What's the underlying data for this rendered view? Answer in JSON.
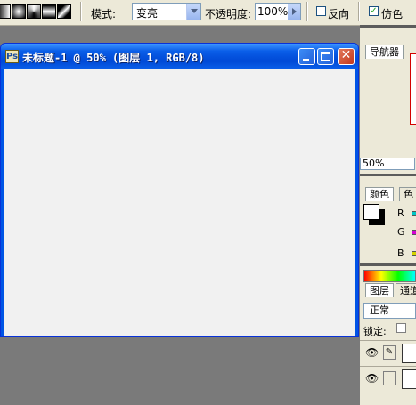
{
  "options_bar": {
    "gradient_types": [
      "linear-gradient-icon",
      "radial-gradient-icon",
      "angle-gradient-icon",
      "reflected-gradient-icon",
      "diamond-gradient-icon"
    ],
    "mode_label": "模式:",
    "mode_value": "变亮",
    "opacity_label": "不透明度:",
    "opacity_value": "100%",
    "reverse_label": "反向",
    "reverse_checked": false,
    "dither_label": "仿色",
    "dither_checked": true,
    "check_mark": "✓"
  },
  "document": {
    "title": "未标题-1 @ 50% (图层 1, RGB/8)",
    "icon_glyph": "Ps",
    "close_glyph": "✕",
    "canvas_color": "#f1f1f1"
  },
  "panels": {
    "navigator_tab": "导航器",
    "zoom_value": "50%",
    "color_tab": "颜色",
    "color_tab2": "色",
    "channels": [
      "R",
      "G",
      "B"
    ],
    "layers_tab": "图层",
    "channels_tab": "通道",
    "blend_mode": "正常",
    "lock_label": "锁定:",
    "eye_glyph": "👁",
    "brush_glyph": "✎",
    "foreground_color": "#ffffff",
    "background_color": "#000000"
  }
}
